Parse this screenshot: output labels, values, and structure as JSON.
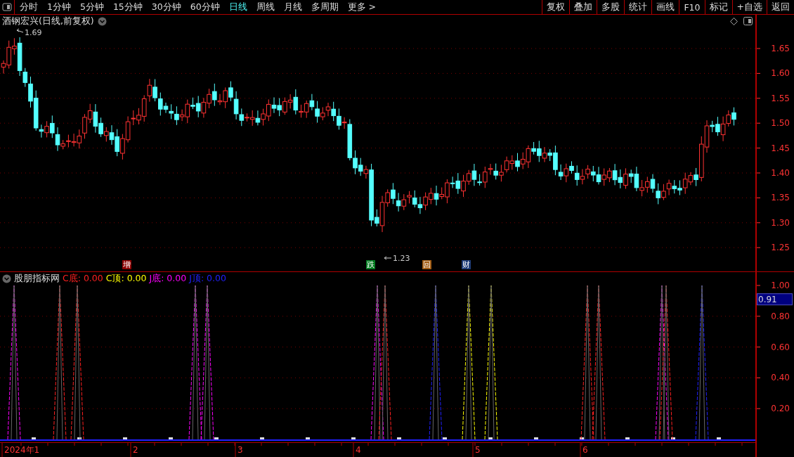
{
  "toolbar": {
    "periods": [
      {
        "label": "分时",
        "selected": false
      },
      {
        "label": "1分钟",
        "selected": false
      },
      {
        "label": "5分钟",
        "selected": false
      },
      {
        "label": "15分钟",
        "selected": false
      },
      {
        "label": "30分钟",
        "selected": false
      },
      {
        "label": "60分钟",
        "selected": false
      },
      {
        "label": "日线",
        "selected": true
      },
      {
        "label": "周线",
        "selected": false
      },
      {
        "label": "月线",
        "selected": false
      },
      {
        "label": "多周期",
        "selected": false
      },
      {
        "label": "更多 >",
        "selected": false
      }
    ],
    "actions": [
      "复权",
      "叠加",
      "多股",
      "统计",
      "画线",
      "F10",
      "标记",
      "+自选",
      "返回"
    ]
  },
  "price_chart": {
    "title": "酒钢宏兴(日线,前复权)",
    "high_label": "1.69",
    "low_label": "1.23",
    "y_ticks": [
      "1.65",
      "1.60",
      "1.55",
      "1.50",
      "1.45",
      "1.40",
      "1.35",
      "1.30",
      "1.25"
    ],
    "events": [
      {
        "label": "增",
        "color": "#8b0000"
      },
      {
        "label": "跌",
        "color": "#007a1e"
      },
      {
        "label": "回",
        "color": "#a05a10"
      },
      {
        "label": "财",
        "color": "#1e3c78"
      }
    ]
  },
  "indicator": {
    "name": "股朋指标网",
    "series": [
      {
        "label": "C底:",
        "value": "0.00",
        "color": "#ff2020"
      },
      {
        "label": "C顶:",
        "value": "0.00",
        "color": "#ffff00"
      },
      {
        "label": "J底:",
        "value": "0.00",
        "color": "#ff00ff"
      },
      {
        "label": "J顶:",
        "value": "0.00",
        "color": "#2020ff"
      }
    ],
    "y_ticks": [
      "1.00",
      "0.80",
      "0.60",
      "0.40",
      "0.20"
    ],
    "current_value": "0.91"
  },
  "time_axis": {
    "labels": [
      "2024年1",
      "2",
      "3",
      "4",
      "5",
      "6"
    ]
  }
}
